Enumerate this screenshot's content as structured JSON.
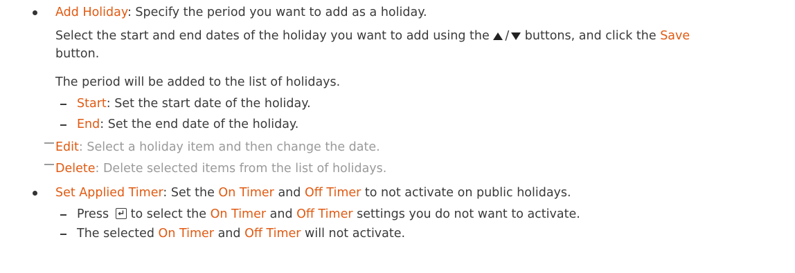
{
  "add_holiday": {
    "label": "Add Holiday",
    "desc": ": Specify the period you want to add as a holiday.",
    "line2_a": "Select the start and end dates of the holiday you want to add using the ",
    "line2_b": " buttons, and click the ",
    "save_label": "Save",
    "line3": "button.",
    "line4": "The period will be added to the list of holidays.",
    "start_label": "Start",
    "start_desc": ": Set the start date of the holiday.",
    "end_label": "End",
    "end_desc": ": Set the end date of the holiday."
  },
  "notes": {
    "edit_label": "Edit",
    "edit_desc": ": Select a holiday item and then change the date.",
    "delete_label": "Delete",
    "delete_desc": ": Delete selected items from the list of holidays."
  },
  "applied_timer": {
    "label": "Set Applied Timer",
    "desc_a": ": Set the ",
    "on_timer": "On Timer",
    "and": " and ",
    "off_timer": "Off Timer",
    "desc_b": " to not activate on public holidays.",
    "sub1_a": "Press ",
    "sub1_b": "to select the ",
    "sub1_c": " settings you do not want to activate.",
    "sub2_a": "The selected ",
    "sub2_b": " will not activate."
  },
  "colors": {
    "highlight": "#e05a12",
    "note": "#9a9a9a",
    "text": "#3a3a3a"
  },
  "icons": [
    "up-triangle-icon",
    "down-triangle-icon",
    "enter-key-icon"
  ]
}
